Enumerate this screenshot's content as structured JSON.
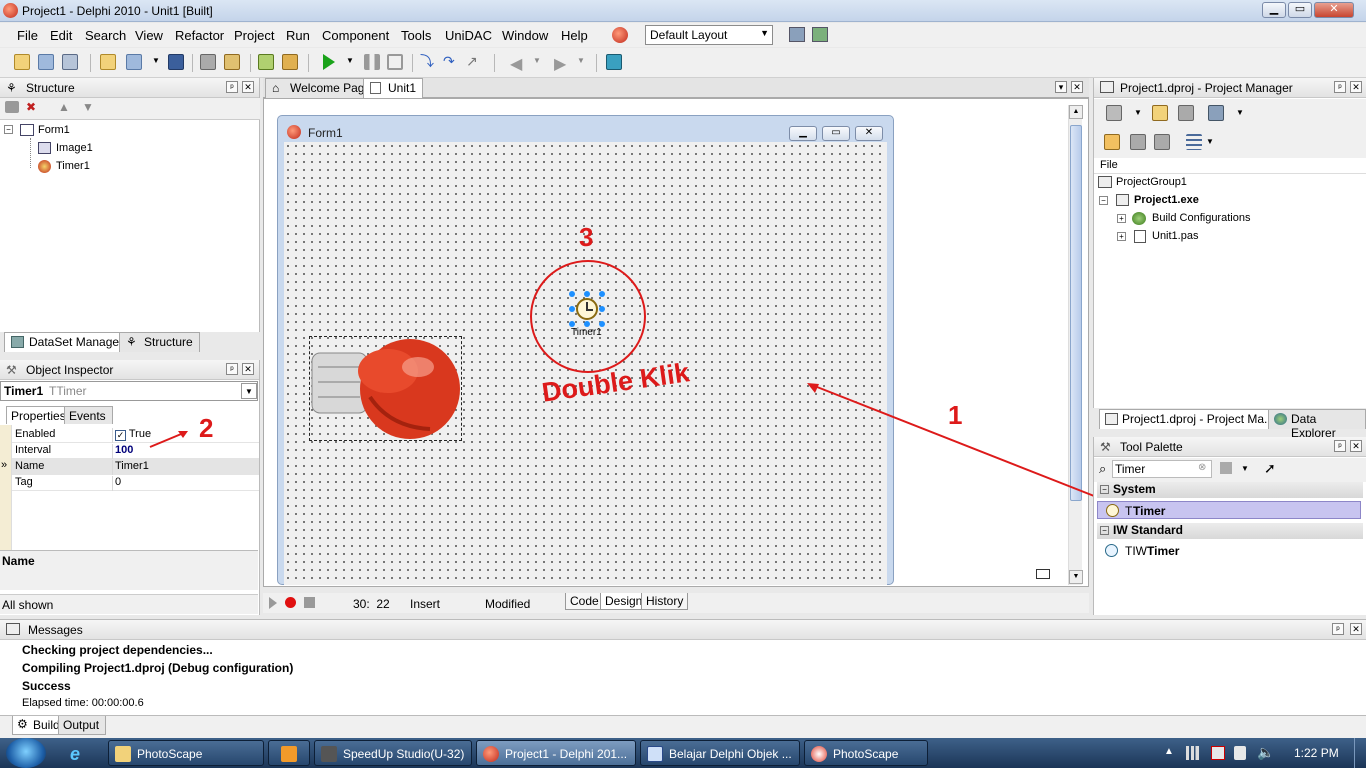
{
  "window": {
    "title": "Project1 - Delphi 2010 - Unit1 [Built]",
    "min": "▁",
    "max": "▭",
    "close": "✕"
  },
  "menu": [
    "File",
    "Edit",
    "Search",
    "View",
    "Refactor",
    "Project",
    "Run",
    "Component",
    "Tools",
    "UniDAC",
    "Window",
    "Help"
  ],
  "layout_select": "Default Layout",
  "structure": {
    "title": "Structure",
    "tree": [
      "Form1",
      "Image1",
      "Timer1"
    ],
    "tabs": [
      "DataSet Manager",
      "Structure"
    ]
  },
  "object_inspector": {
    "title": "Object Inspector",
    "selected_name": "Timer1",
    "selected_type": "TTimer",
    "tabs": [
      "Properties",
      "Events"
    ],
    "properties": [
      {
        "key": "Enabled",
        "value": "True"
      },
      {
        "key": "Interval",
        "value": "100"
      },
      {
        "key": "Name",
        "value": "Timer1"
      },
      {
        "key": "Tag",
        "value": "0"
      }
    ],
    "desc_title": "Name",
    "status": "All shown"
  },
  "editor": {
    "tabs": [
      "Welcome Page",
      "Unit1"
    ],
    "form_title": "Form1",
    "timer_label": "Timer1",
    "status": {
      "position": "30:  22",
      "mode": "Insert",
      "state": "Modified"
    },
    "bottom_tabs": [
      "Code",
      "Design",
      "History"
    ]
  },
  "annotations": {
    "one": "1",
    "two": "2",
    "three": "3",
    "double_klik": "Double Klik"
  },
  "project_manager": {
    "title": "Project1.dproj - Project Manager",
    "column": "File",
    "tree": [
      "ProjectGroup1",
      "Project1.exe",
      "Build Configurations",
      "Unit1.pas"
    ],
    "tabs": [
      "Project1.dproj - Project Ma...",
      "Data Explorer"
    ]
  },
  "tool_palette": {
    "title": "Tool Palette",
    "search_value": "Timer",
    "categories": [
      {
        "name": "System",
        "items": [
          {
            "prefix": "T",
            "bold": "Timer"
          }
        ]
      },
      {
        "name": "IW Standard",
        "items": [
          {
            "prefix": "TIW",
            "bold": "Timer"
          }
        ]
      }
    ]
  },
  "messages": {
    "title": "Messages",
    "lines": [
      "Checking project dependencies...",
      "Compiling Project1.dproj (Debug configuration)",
      "Success",
      "Elapsed time: 00:00:00.6"
    ],
    "tabs": [
      "Build",
      "Output"
    ]
  },
  "taskbar": {
    "tasks": [
      "PhotoScape",
      "",
      "SpeedUp Studio(U-32)",
      "Project1 - Delphi 201...",
      "Belajar Delphi Objek ...",
      "PhotoScape"
    ],
    "clock": "1:22 PM"
  },
  "colors": {
    "annotation_red": "#dd1a1a",
    "selection_blue": "#1e90ff",
    "palette_highlight": "#c8c4f0"
  }
}
